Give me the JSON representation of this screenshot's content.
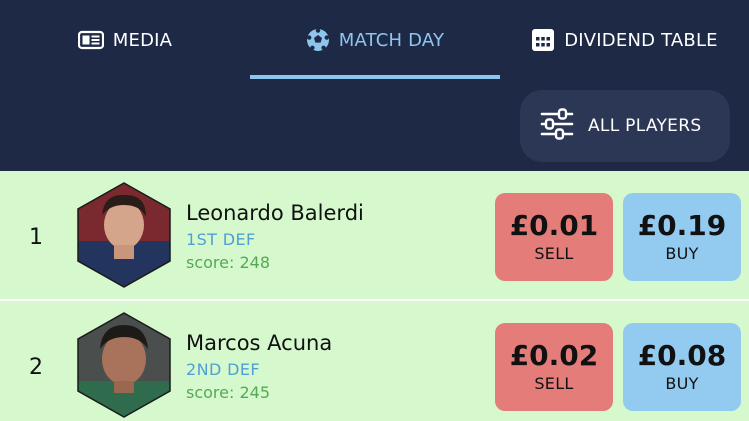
{
  "tabs": [
    {
      "label": "MEDIA",
      "icon": "newspaper-icon",
      "active": false
    },
    {
      "label": "MATCH DAY",
      "icon": "soccer-ball-icon",
      "active": true
    },
    {
      "label": "DIVIDEND TABLE",
      "icon": "grid-table-icon",
      "active": false
    }
  ],
  "filter": {
    "label": "ALL PLAYERS",
    "icon": "sliders-icon"
  },
  "colors": {
    "header_bg": "#1e2945",
    "active_tab": "#8ec5ef",
    "row_bg": "#d5f9cd",
    "sell": "#e47d7a",
    "buy": "#92caf0",
    "position_text": "#4f9fd4",
    "score_text": "#56a953"
  },
  "players": [
    {
      "rank": "1",
      "name": "Leonardo Balerdi",
      "position": "1ST DEF",
      "score": "score: 248",
      "sell_price": "£0.01",
      "sell_label": "SELL",
      "buy_price": "£0.19",
      "buy_label": "BUY"
    },
    {
      "rank": "2",
      "name": "Marcos Acuna",
      "position": "2ND DEF",
      "score": "score: 245",
      "sell_price": "£0.02",
      "sell_label": "SELL",
      "buy_price": "£0.08",
      "buy_label": "BUY"
    }
  ]
}
